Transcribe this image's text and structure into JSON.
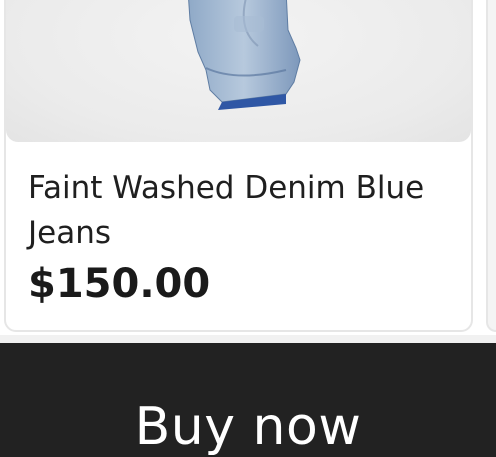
{
  "product": {
    "title": "Faint Washed Denim Blue Jeans",
    "price": "$150.00",
    "image_icon": "jeans-image"
  },
  "cta": {
    "label": "Buy now"
  },
  "colors": {
    "button_bg": "#222222",
    "card_border": "#e6e6e6",
    "image_bg": "#ebebeb",
    "denim": "#6f8fb5"
  }
}
